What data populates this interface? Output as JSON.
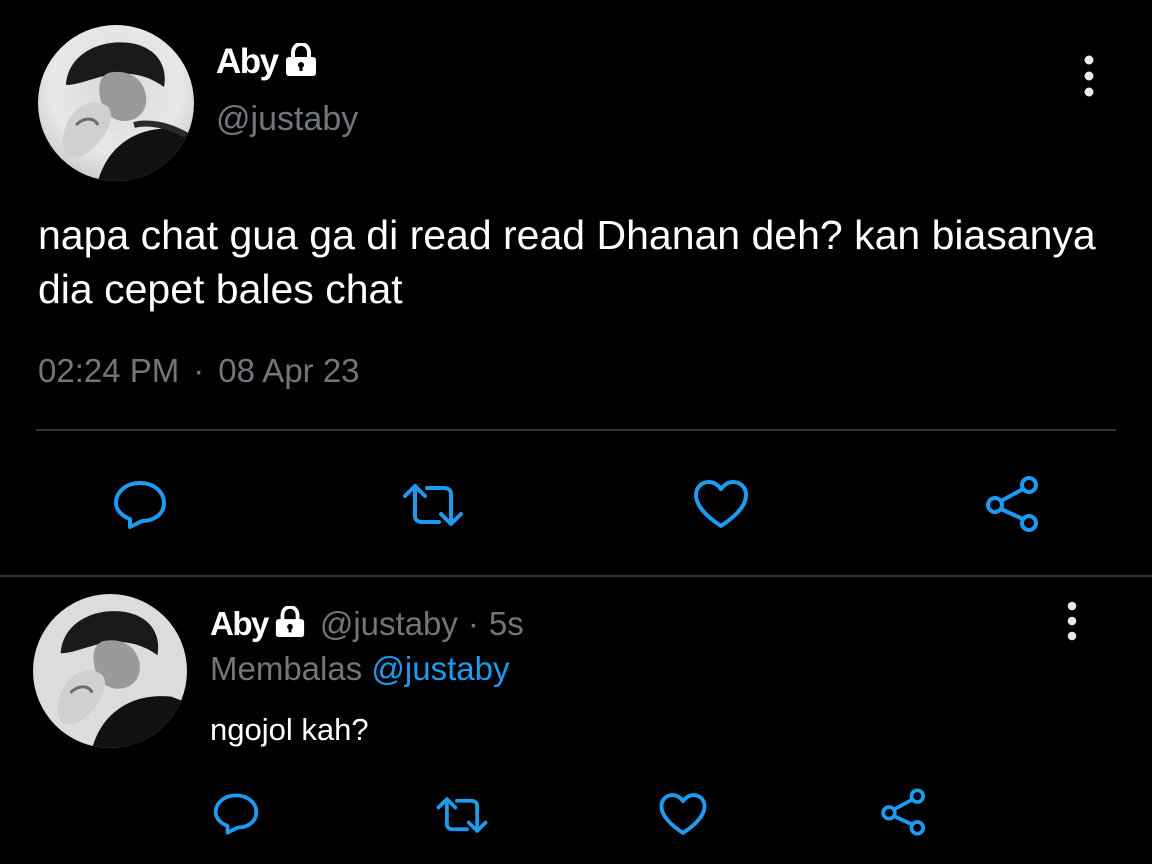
{
  "main_tweet": {
    "author_name": "Aby",
    "handle": "@justaby",
    "text": "napa chat gua ga di read read Dhanan deh? kan biasanya dia cepet bales chat",
    "time": "02:24 PM",
    "separator": "·",
    "date": "08 Apr 23",
    "icons": {
      "protected": "lock-icon",
      "more": "more-vertical-icon",
      "reply": "comment-icon",
      "retweet": "retweet-icon",
      "like": "heart-icon",
      "share": "share-icon"
    }
  },
  "reply_tweet": {
    "author_name": "Aby",
    "handle": "@justaby",
    "separator": "·",
    "time_ago": "5s",
    "replying_prefix": "Membalas",
    "replying_to": "@justaby",
    "text": "ngojol kah?"
  },
  "colors": {
    "background": "#000000",
    "text_primary": "#ffffff",
    "text_secondary": "#71767b",
    "accent": "#1d9bf0",
    "divider": "#2f3336"
  }
}
